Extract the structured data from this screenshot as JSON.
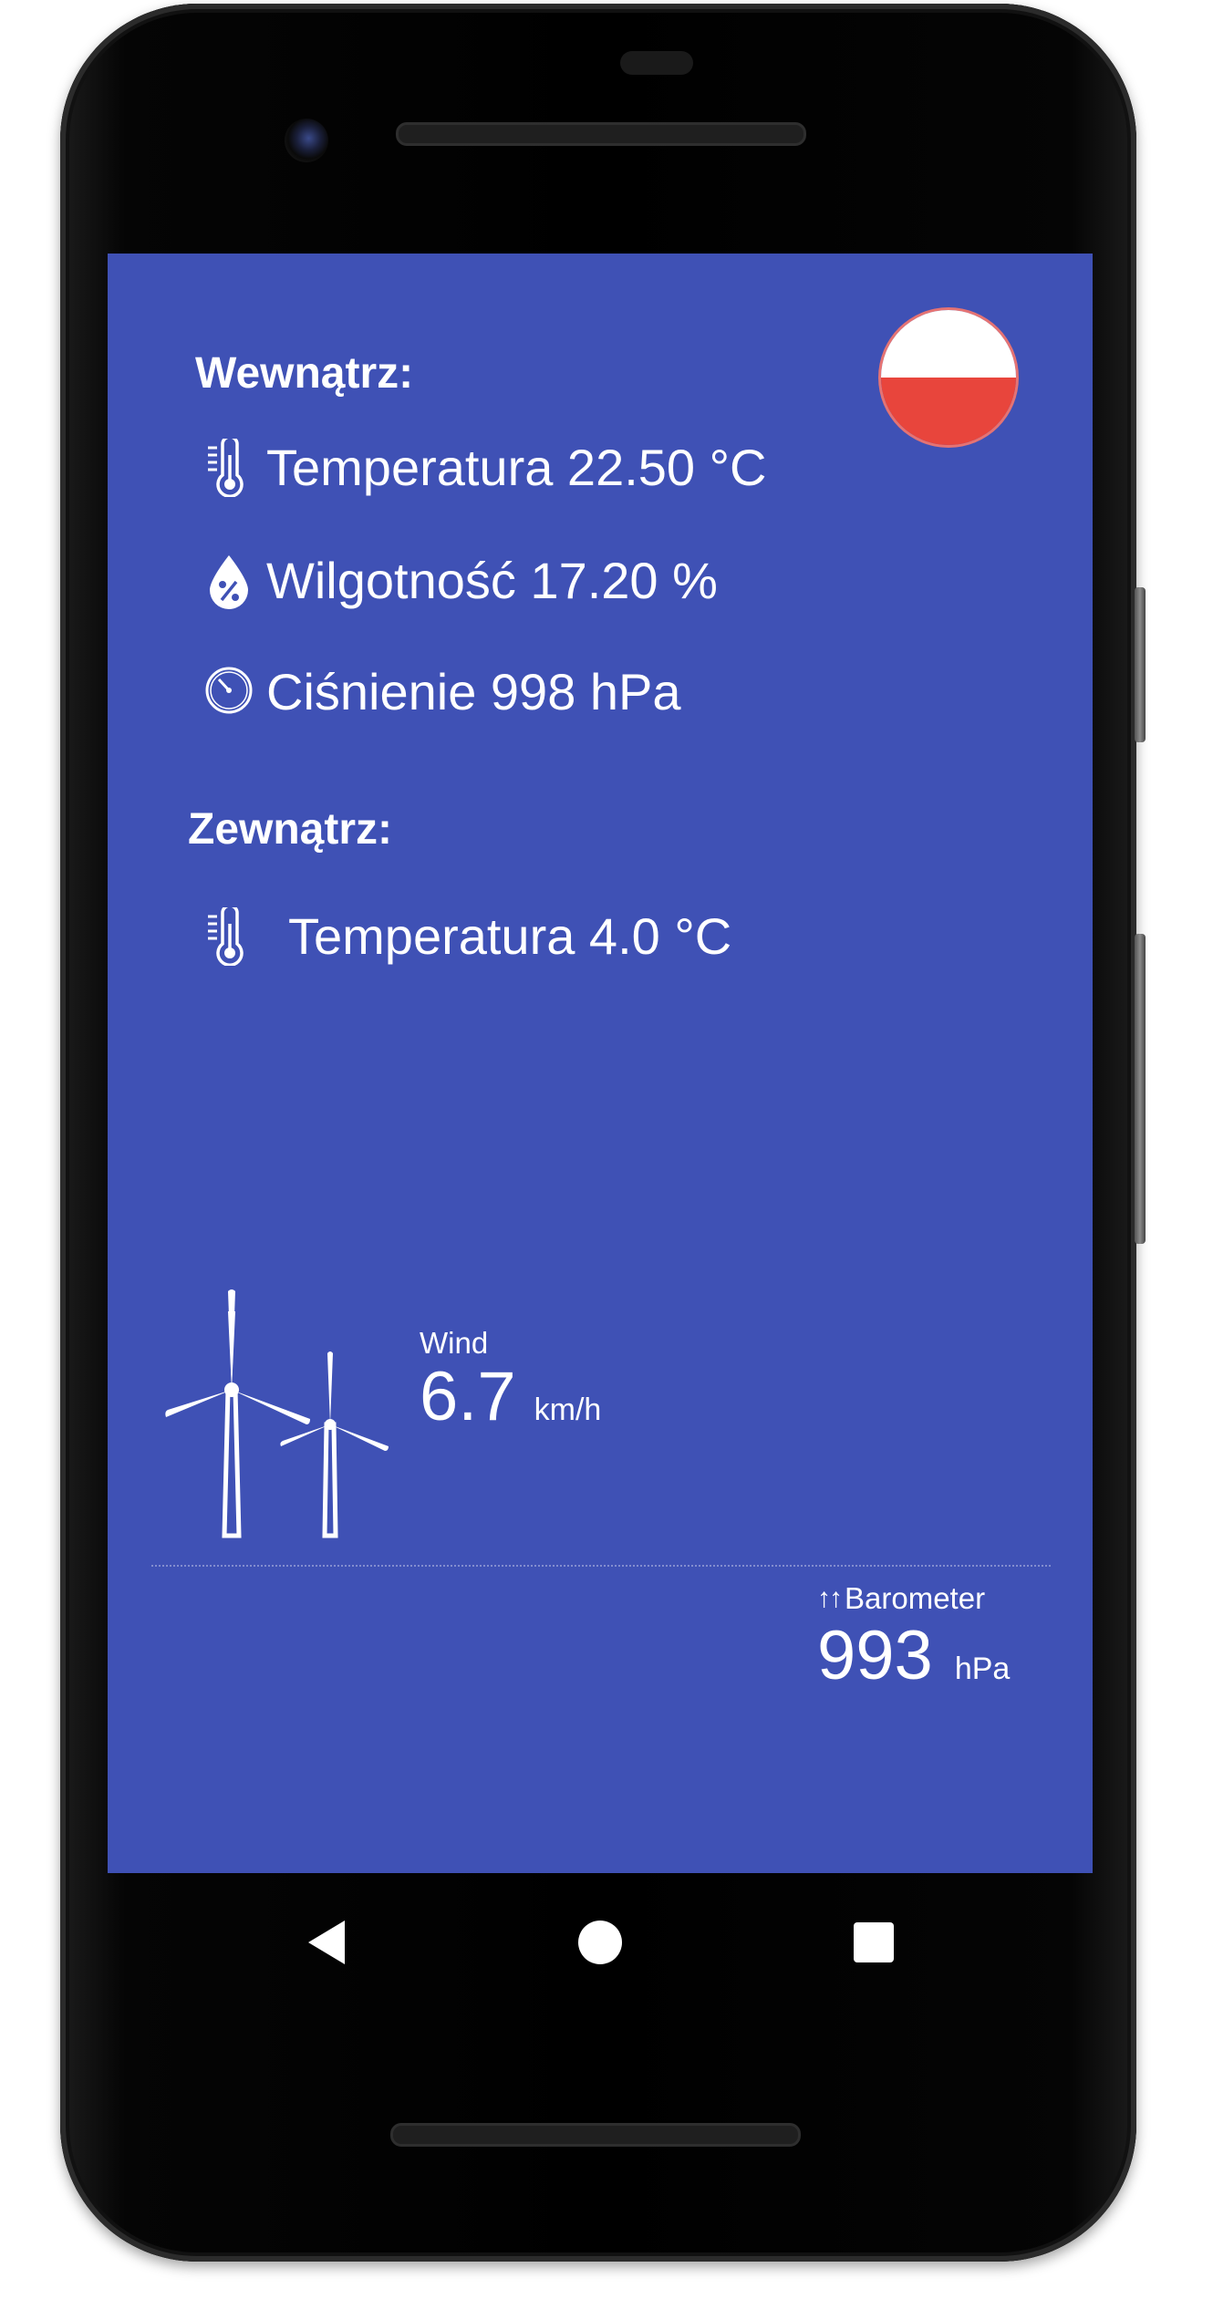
{
  "colors": {
    "screen_background": "#3f51b5",
    "text": "#ffffff",
    "flag_white": "#ffffff",
    "flag_red": "#e8453c"
  },
  "indoor": {
    "title": "Wewnątrz:",
    "temperature": {
      "icon": "thermometer-icon",
      "text": "Temperatura 22.50 °C"
    },
    "humidity": {
      "icon": "humidity-drop-icon",
      "text": "Wilgotność 17.20 %"
    },
    "pressure": {
      "icon": "gauge-icon",
      "text": "Ciśnienie 998 hPa"
    }
  },
  "outdoor": {
    "title": "Zewnątrz:",
    "temperature": {
      "icon": "thermometer-icon",
      "text": "Temperatura 4.0 °C"
    }
  },
  "language_flag": {
    "icon": "poland-flag-icon"
  },
  "wind": {
    "icon": "wind-turbines-icon",
    "label": "Wind",
    "value": "6.7",
    "unit": "km/h"
  },
  "barometer": {
    "icon": "rising-arrows-icon",
    "arrows": "↑↑",
    "label": "Barometer",
    "value": "993",
    "unit": "hPa"
  },
  "navigation": {
    "back": {
      "icon": "back-triangle-icon"
    },
    "home": {
      "icon": "home-circle-icon"
    },
    "recents": {
      "icon": "recents-square-icon"
    }
  }
}
